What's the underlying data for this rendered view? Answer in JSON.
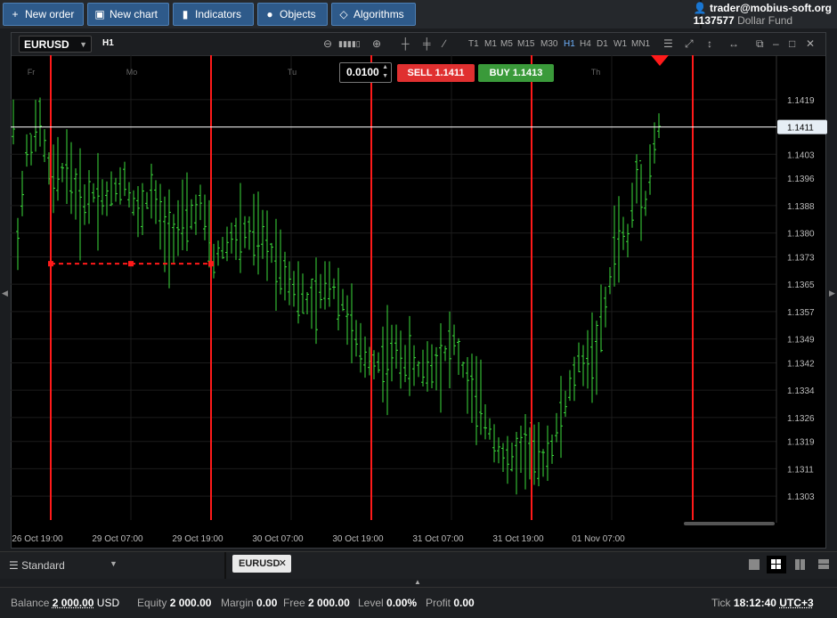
{
  "toolbar": {
    "new_order": "New order",
    "new_chart": "New chart",
    "indicators": "Indicators",
    "objects": "Objects",
    "algorithms": "Algorithms"
  },
  "account": {
    "user": "trader@mobius-soft.org",
    "id": "1137577",
    "fund": "Dollar Fund"
  },
  "chart_header": {
    "symbol": "EURUSD",
    "timeframe": "H1",
    "timeframes": [
      "T1",
      "M1",
      "M5",
      "M15",
      "M30",
      "H1",
      "H4",
      "D1",
      "W1",
      "MN1"
    ],
    "active_timeframe": "H1"
  },
  "trade_panel": {
    "volume": "0.0100",
    "sell_label": "SELL",
    "sell_price": "1.1411",
    "buy_label": "BUY",
    "buy_price": "1.1413"
  },
  "chart_data": {
    "type": "bar",
    "symbol": "EURUSD",
    "ylim": [
      1.1296,
      1.1432
    ],
    "current_price": 1.1411,
    "y_ticks": [
      "1.1419",
      "1.1411",
      "1.1403",
      "1.1396",
      "1.1388",
      "1.1380",
      "1.1373",
      "1.1365",
      "1.1357",
      "1.1349",
      "1.1342",
      "1.1334",
      "1.1326",
      "1.1319",
      "1.1311",
      "1.1303"
    ],
    "x_ticks": [
      "26 Oct 19:00",
      "29 Oct 07:00",
      "29 Oct 19:00",
      "30 Oct 07:00",
      "30 Oct 19:00",
      "31 Oct 07:00",
      "31 Oct 19:00",
      "01 Nov 07:00"
    ],
    "day_labels": [
      "Fr",
      "Mo",
      "Tu",
      "We",
      "Th"
    ],
    "colors": {
      "bars": "#3ddc3d",
      "markers": "#ff1a1a",
      "price_line": "#ffffff",
      "grid": "#1c1c1c"
    }
  },
  "bottom": {
    "template": "Standard",
    "tab": "EURUSD"
  },
  "status": {
    "balance_label": "Balance",
    "balance": "2 000.00",
    "currency": "USD",
    "equity_label": "Equity",
    "equity": "2 000.00",
    "margin_label": "Margin",
    "margin": "0.00",
    "free_label": "Free",
    "free": "2 000.00",
    "level_label": "Level",
    "level": "0.00%",
    "profit_label": "Profit",
    "profit": "0.00",
    "tick_label": "Tick",
    "time": "18:12:40",
    "tz": "UTC+3"
  }
}
